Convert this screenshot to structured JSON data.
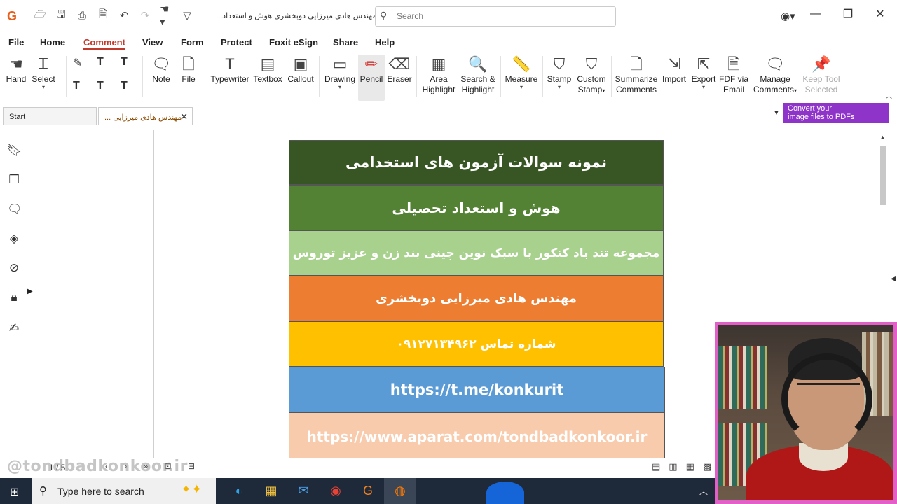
{
  "app": {
    "doc_title": "...مهندس هادی میرزایی دوبخشری  هوش و استعداد",
    "search_placeholder": "Search"
  },
  "menu": [
    "File",
    "Home",
    "Comment",
    "View",
    "Form",
    "Protect",
    "Foxit eSign",
    "Share",
    "Help"
  ],
  "active_menu": "Comment",
  "ribbon": {
    "hand": "Hand",
    "select": "Select",
    "note": "Note",
    "file": "File",
    "typewriter": "Typewriter",
    "textbox": "Textbox",
    "callout": "Callout",
    "drawing": "Drawing",
    "pencil": "Pencil",
    "eraser": "Eraser",
    "area_highlight_1": "Area",
    "area_highlight_2": "Highlight",
    "search_highlight_1": "Search &",
    "search_highlight_2": "Highlight",
    "measure": "Measure",
    "stamp": "Stamp",
    "custom_stamp_1": "Custom",
    "custom_stamp_2": "Stamp",
    "summarize_1": "Summarize",
    "summarize_2": "Comments",
    "import": "Import",
    "export": "Export",
    "fdf_1": "FDF via",
    "fdf_2": "Email",
    "manage_1": "Manage",
    "manage_2": "Comments",
    "keep_1": "Keep Tool",
    "keep_2": "Selected"
  },
  "tabs": {
    "start": "Start",
    "doc": "... مهندس هادی میرزایی"
  },
  "promo": {
    "line1": "Convert your",
    "line2": "image files to PDFs"
  },
  "page": {
    "band1": "نمونه سوالات آزمون های استخدامی",
    "band2": "هوش و استعداد تحصیلی",
    "band3": "مجموعه تند باد کنکور با سبک نوین چینی بند زن و عزیز توروس",
    "band4": "مهندس هادی میرزایی دوبخشری",
    "band5": "شماره تماس ۰۹۱۲۷۱۳۴۹۶۲",
    "band6": "https://t.me/konkurit",
    "band7": "https://www.aparat.com/tondbadkonkoor.ir"
  },
  "status": {
    "page": "1 / 5"
  },
  "watermark": "@tondbadkonkoor.ir",
  "taskbar": {
    "search_text": "Type here to search"
  }
}
